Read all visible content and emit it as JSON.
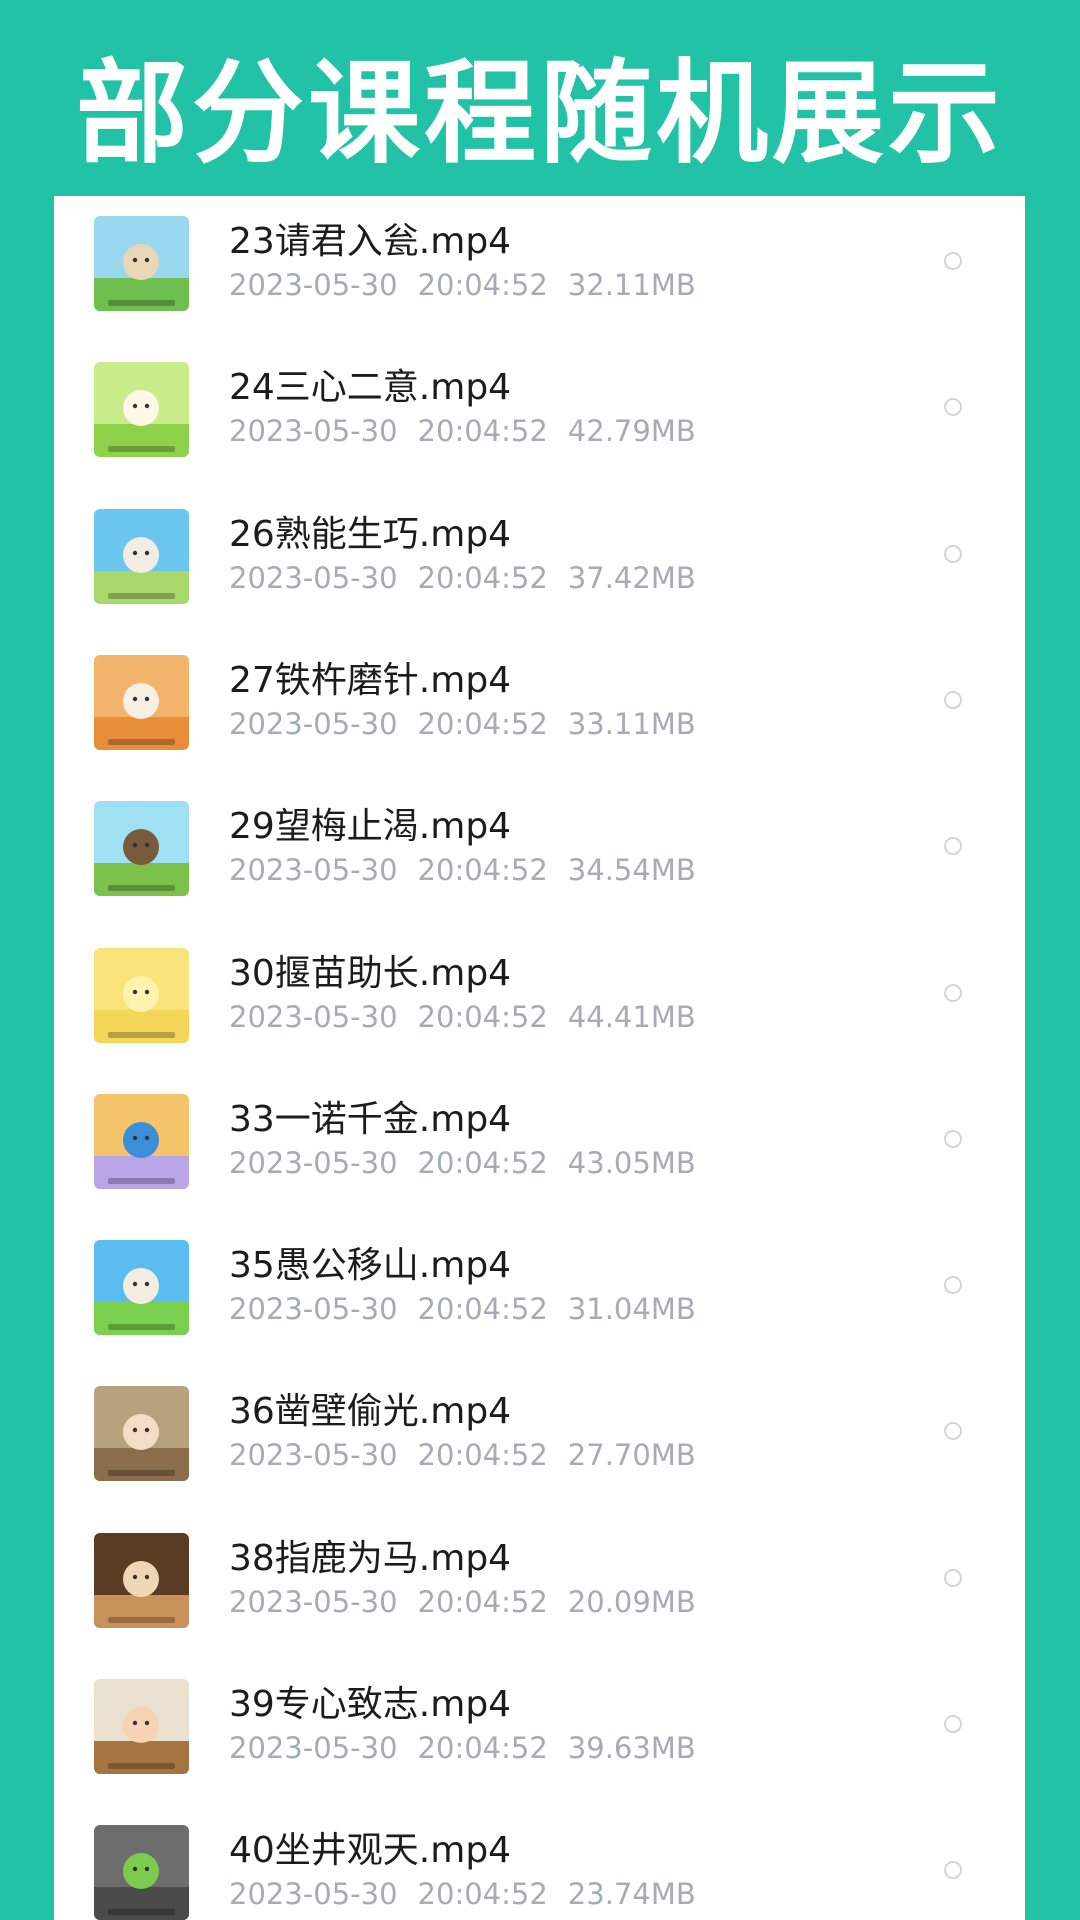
{
  "header": {
    "title": "部分课程随机展示"
  },
  "files": [
    {
      "name": "23请君入瓮.mp4",
      "date": "2023-05-30",
      "time": "20:04:52",
      "size": "32.11MB",
      "thumb_colors": [
        "#9ad8f0",
        "#6fbf4e",
        "#e9d7b8"
      ]
    },
    {
      "name": "24三心二意.mp4",
      "date": "2023-05-30",
      "time": "20:04:52",
      "size": "42.79MB",
      "thumb_colors": [
        "#c9ec8a",
        "#8ed14a",
        "#fff8e6"
      ]
    },
    {
      "name": "26熟能生巧.mp4",
      "date": "2023-05-30",
      "time": "20:04:52",
      "size": "37.42MB",
      "thumb_colors": [
        "#6cc7ef",
        "#a9d86a",
        "#f1ede4"
      ]
    },
    {
      "name": "27铁杵磨针.mp4",
      "date": "2023-05-30",
      "time": "20:04:52",
      "size": "33.11MB",
      "thumb_colors": [
        "#f2b36a",
        "#e88d3a",
        "#f6efe3"
      ]
    },
    {
      "name": "29望梅止渴.mp4",
      "date": "2023-05-30",
      "time": "20:04:52",
      "size": "34.54MB",
      "thumb_colors": [
        "#9fe0f2",
        "#7cc24a",
        "#7a5a3c"
      ]
    },
    {
      "name": "30揠苗助长.mp4",
      "date": "2023-05-30",
      "time": "20:04:52",
      "size": "44.41MB",
      "thumb_colors": [
        "#f8e47a",
        "#f3d659",
        "#fff3b0"
      ]
    },
    {
      "name": "33一诺千金.mp4",
      "date": "2023-05-30",
      "time": "20:04:52",
      "size": "43.05MB",
      "thumb_colors": [
        "#f5c46a",
        "#b9a6e6",
        "#3a8fd8"
      ]
    },
    {
      "name": "35愚公移山.mp4",
      "date": "2023-05-30",
      "time": "20:04:52",
      "size": "31.04MB",
      "thumb_colors": [
        "#5bbcf0",
        "#7cd04f",
        "#f3ede2"
      ]
    },
    {
      "name": "36凿壁偷光.mp4",
      "date": "2023-05-30",
      "time": "20:04:52",
      "size": "27.70MB",
      "thumb_colors": [
        "#b8a27e",
        "#8a6d4a",
        "#f5dcc4"
      ]
    },
    {
      "name": "38指鹿为马.mp4",
      "date": "2023-05-30",
      "time": "20:04:52",
      "size": "20.09MB",
      "thumb_colors": [
        "#5a3b24",
        "#c9925a",
        "#efd7b5"
      ]
    },
    {
      "name": "39专心致志.mp4",
      "date": "2023-05-30",
      "time": "20:04:52",
      "size": "39.63MB",
      "thumb_colors": [
        "#e9e0cf",
        "#a5743f",
        "#f6d3b3"
      ]
    },
    {
      "name": "40坐井观天.mp4",
      "date": "2023-05-30",
      "time": "20:04:52",
      "size": "23.74MB",
      "thumb_colors": [
        "#6d6d6d",
        "#4a4a4a",
        "#7ccb4f"
      ]
    }
  ]
}
